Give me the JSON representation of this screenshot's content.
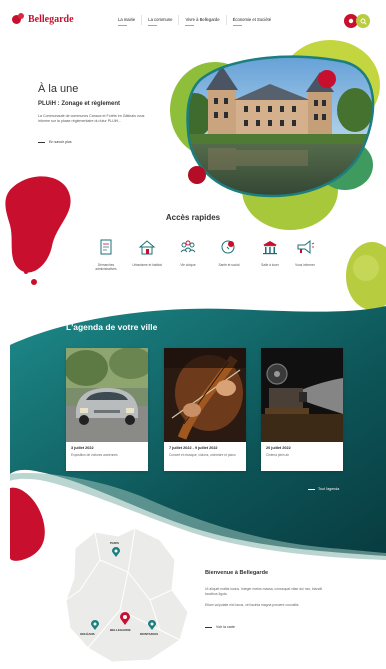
{
  "header": {
    "logo_text": "Bellegarde",
    "nav": [
      "La mairie",
      "La commune",
      "Vivre à Bellegarde",
      "Économie et Société"
    ],
    "accent_red": "#c8102e",
    "accent_green": "#9ac13c",
    "icons": [
      "alert-icon",
      "search-icon"
    ]
  },
  "hero": {
    "section_title": "À la une",
    "news_title": "PLUiH : Zonage et règlement",
    "news_text": "La Communauté de communes Canaux et Forêts en Gâtinais vous informe sur la phase réglementaire du futur PLUiH...",
    "read_more": "En savoir plus"
  },
  "quick_access": {
    "title": "Accès rapides",
    "items": [
      {
        "label": "Démarches administratives",
        "icon": "document-icon"
      },
      {
        "label": "Urbanisme et habitat",
        "icon": "house-icon"
      },
      {
        "label": "Vie civique",
        "icon": "people-icon"
      },
      {
        "label": "Santé et social",
        "icon": "health-icon"
      },
      {
        "label": "Salle à louer",
        "icon": "building-icon"
      },
      {
        "label": "Vous informer",
        "icon": "megaphone-icon"
      }
    ]
  },
  "agenda": {
    "title": "L'agenda de votre ville",
    "events": [
      {
        "date": "3 juillet 2022",
        "desc": "Exposition de voitures anciennes",
        "image": "vintage-car-photo"
      },
      {
        "date": "7 juillet 2022 - 9 juillet 2022",
        "desc": "Concert et musique, violons, orchestre et piano",
        "image": "violin-photo"
      },
      {
        "date": "20 juillet 2022",
        "desc": "Cinéma plein air",
        "image": "projector-photo"
      }
    ],
    "all_link": "Tout l'agenda",
    "colors": {
      "teal_dark": "#0f4a4d",
      "teal": "#1b7e7f"
    }
  },
  "welcome": {
    "title": "Bienvenue à Bellegarde",
    "p1": "Ut aliquet mattis luctus. Integer metus massa, consequat vitae dui nec, blandit faucibus ligula.",
    "p2": "Etiam vulputate nisl lacus, vel lacinia magna posuere convallis.",
    "link": "Voir la carte"
  },
  "map": {
    "labels": [
      "PARIS",
      "ORLÉANS",
      "BELLEGARDE",
      "MONTARGIS"
    ]
  }
}
